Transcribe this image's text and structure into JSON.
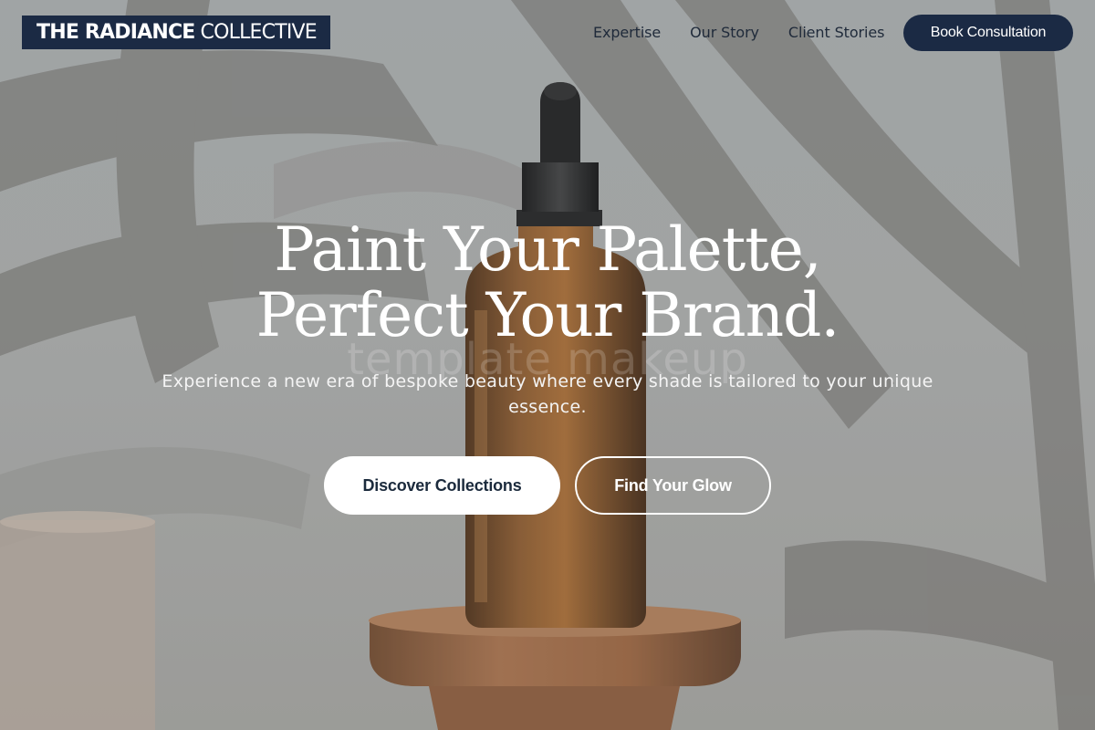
{
  "brand": {
    "name_bold": "THE RADIANCE",
    "name_light": "COLLECTIVE"
  },
  "nav": {
    "links": [
      "Expertise",
      "Our Story",
      "Client Stories"
    ],
    "cta_label": "Book Consultation"
  },
  "hero": {
    "headline_line1": "Paint Your Palette,",
    "headline_line2": "Perfect Your Brand.",
    "watermark": "template makeup",
    "subtext": "Experience a new era of bespoke beauty where every shade is tailored to your unique essence.",
    "primary_button": "Discover Collections",
    "secondary_button": "Find Your Glow"
  },
  "colors": {
    "navy": "#1b2a44",
    "white": "#ffffff",
    "amber_bottle": "#7a4a22",
    "wood_pedestal": "#9a6440"
  }
}
